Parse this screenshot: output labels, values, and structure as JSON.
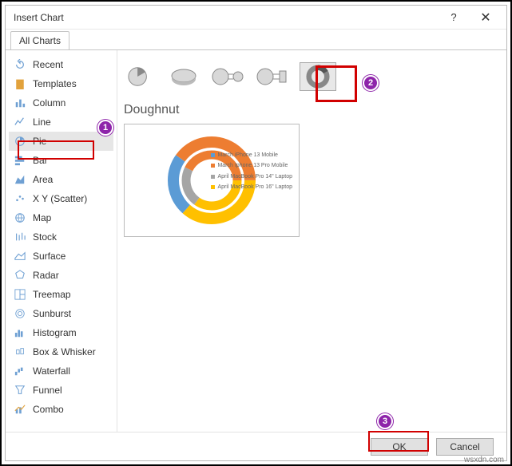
{
  "dialog": {
    "title": "Insert Chart",
    "help": "?",
    "close": "✕",
    "tab": "All Charts"
  },
  "sidebar": {
    "items": [
      {
        "label": "Recent"
      },
      {
        "label": "Templates"
      },
      {
        "label": "Column"
      },
      {
        "label": "Line"
      },
      {
        "label": "Pie"
      },
      {
        "label": "Bar"
      },
      {
        "label": "Area"
      },
      {
        "label": "X Y (Scatter)"
      },
      {
        "label": "Map"
      },
      {
        "label": "Stock"
      },
      {
        "label": "Surface"
      },
      {
        "label": "Radar"
      },
      {
        "label": "Treemap"
      },
      {
        "label": "Sunburst"
      },
      {
        "label": "Histogram"
      },
      {
        "label": "Box & Whisker"
      },
      {
        "label": "Waterfall"
      },
      {
        "label": "Funnel"
      },
      {
        "label": "Combo"
      }
    ]
  },
  "subtypes": {
    "heading": "Doughnut"
  },
  "preview": {
    "legend": [
      {
        "label": "March iPhone 13 Mobile",
        "color": "#5b9bd5"
      },
      {
        "label": "March Iphone 13 Pro Mobile",
        "color": "#ed7d31"
      },
      {
        "label": "April MacBook Pro 14\" Laptop",
        "color": "#a5a5a5"
      },
      {
        "label": "April MacBook Pro 16\" Laptop",
        "color": "#ffc000"
      }
    ]
  },
  "footer": {
    "ok": "OK",
    "cancel": "Cancel"
  },
  "annotations": {
    "b1": "1",
    "b2": "2",
    "b3": "3"
  },
  "watermark": "wsxdn.com"
}
